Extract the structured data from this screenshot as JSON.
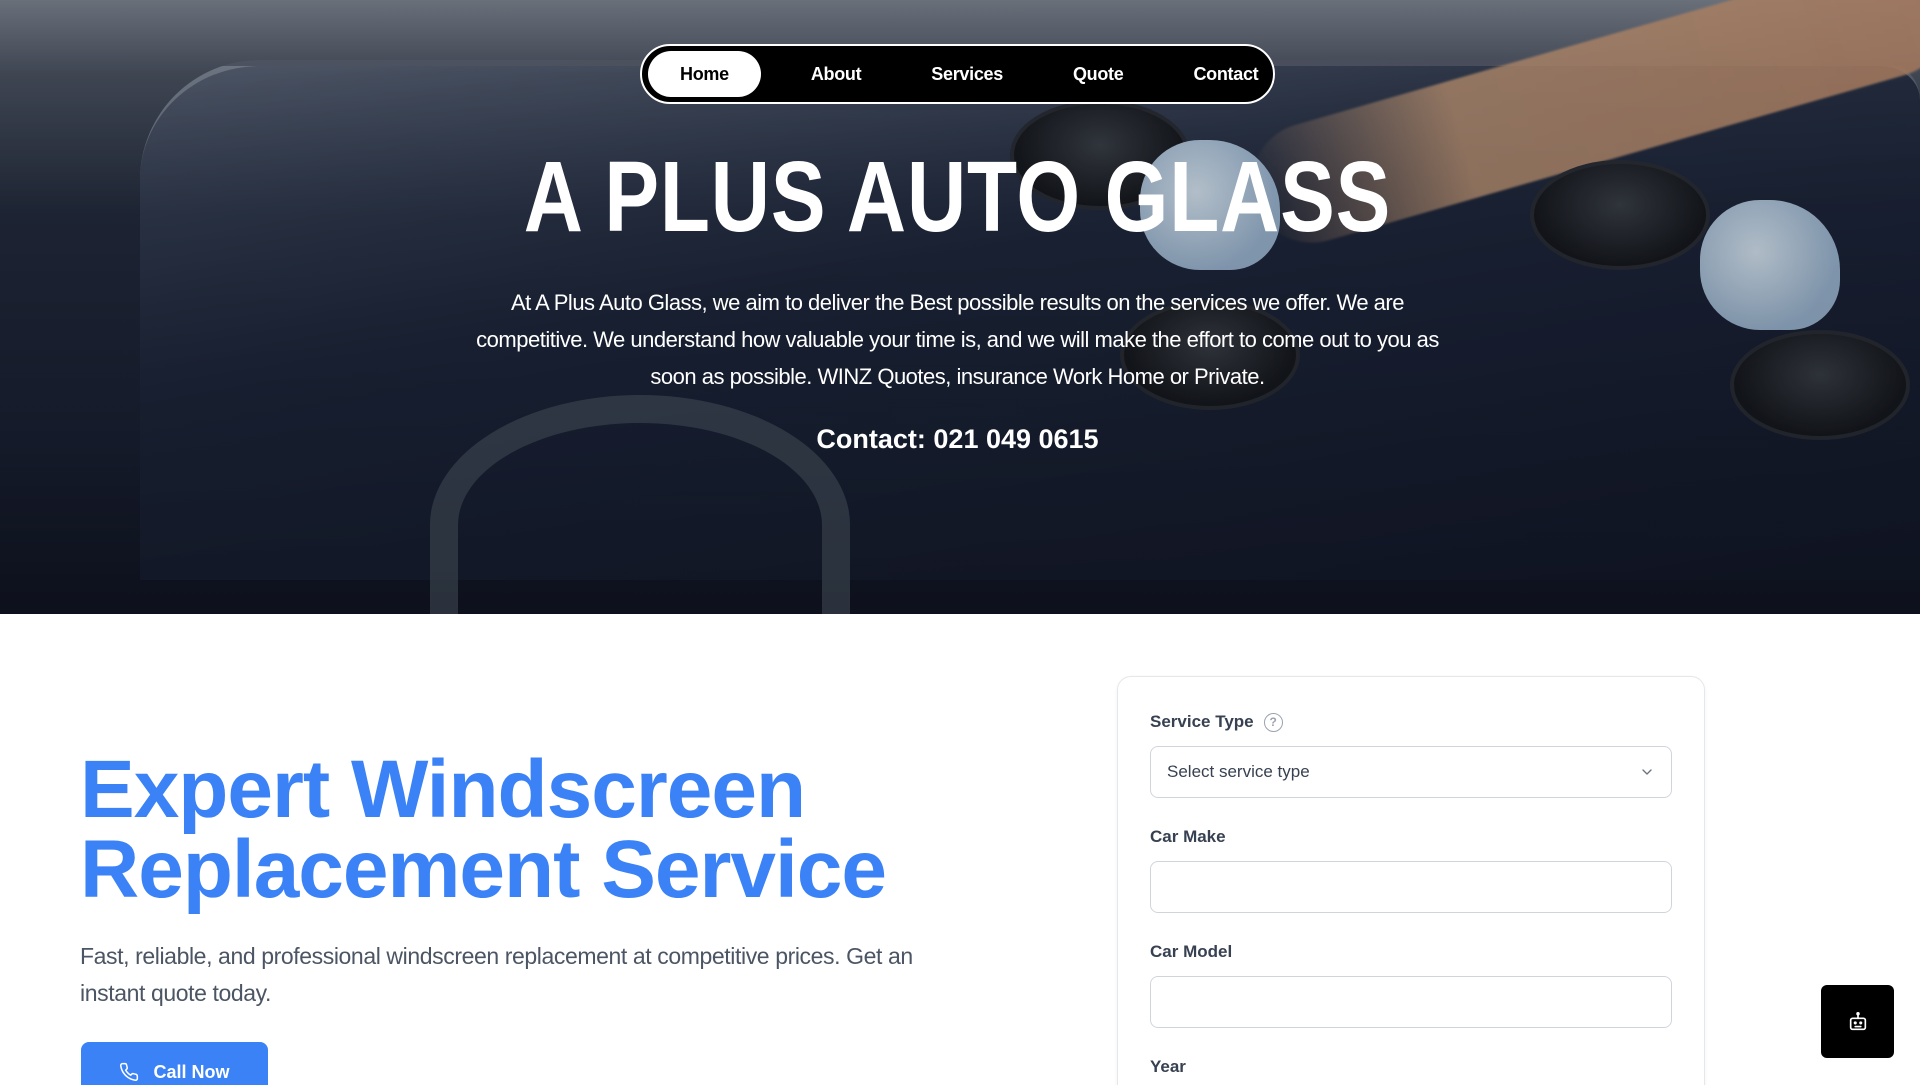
{
  "nav": {
    "items": [
      {
        "label": "Home",
        "active": true
      },
      {
        "label": "About",
        "active": false
      },
      {
        "label": "Services",
        "active": false
      },
      {
        "label": "Quote",
        "active": false
      },
      {
        "label": "Contact",
        "active": false
      }
    ]
  },
  "hero": {
    "title": "A PLUS AUTO GLASS",
    "description": "At A Plus Auto Glass, we aim to deliver the Best possible results on the services we offer. We are competitive. We understand how valuable your time is, and we will make the effort to come out to you as soon as possible. WINZ Quotes, insurance Work Home or Private.",
    "contact": "Contact: 021 049 0615"
  },
  "main": {
    "headline_line1": "Expert Windscreen",
    "headline_line2": "Replacement Service",
    "subtext": "Fast, reliable, and professional windscreen replacement at competitive prices. Get an instant quote today.",
    "call_button": "Call Now"
  },
  "form": {
    "service_type_label": "Service Type",
    "service_type_placeholder": "Select service type",
    "car_make_label": "Car Make",
    "car_make_value": "",
    "car_model_label": "Car Model",
    "car_model_value": "",
    "year_label": "Year"
  },
  "icons": {
    "help": "question-circle-icon",
    "chevron": "chevron-down-icon",
    "phone": "phone-icon",
    "chat": "chatbot-icon"
  },
  "colors": {
    "accent": "#3b82f6",
    "nav_bg": "#000000",
    "nav_active_bg": "#ffffff"
  }
}
